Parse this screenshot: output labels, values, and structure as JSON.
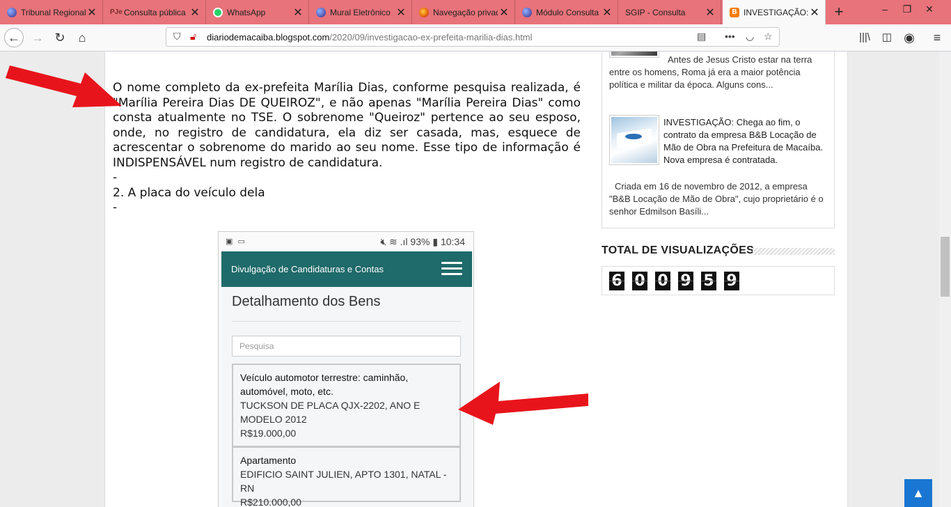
{
  "browser": {
    "tabs": [
      {
        "label": "Tribunal Regional Eleitoral",
        "icon": "globe-icon",
        "color": "#5b4fb3"
      },
      {
        "label": "Consulta pública",
        "icon": "pje-icon",
        "color": "#7a2e2e"
      },
      {
        "label": "WhatsApp",
        "icon": "whatsapp-icon",
        "color": "#25d366"
      },
      {
        "label": "Mural Eletrônico",
        "icon": "globe-icon",
        "color": "#5b4fb3"
      },
      {
        "label": "Navegação privada",
        "icon": "firefox-icon",
        "color": "#e66000"
      },
      {
        "label": "Módulo Consulta",
        "icon": "globe-icon",
        "color": "#5b4fb3"
      },
      {
        "label": "SGIP - Consulta",
        "icon": "",
        "color": ""
      },
      {
        "label": "INVESTIGAÇÃO: Chega ao fim",
        "icon": "blogger-icon",
        "color": "#f57d00"
      }
    ],
    "new_tab": "+",
    "window_buttons": {
      "minimize": "–",
      "restore": "❐",
      "close": "✕"
    },
    "url_host": "diariodemacaiba.blogspot.com",
    "url_path": "/2020/09/investigacao-ex-prefeita-marilia-dias.html"
  },
  "article": {
    "paragraph": "O nome completo da ex-prefeita Marília Dias, conforme pesquisa realizada, é \"Marília Pereira Dias DE QUEIROZ\", e não apenas \"Marília Pereira Dias\" como consta atualmente no TSE. O sobrenome \"Queiroz\" pertence ao seu esposo, onde, no registro de candidatura, ela diz ser casada, mas, esquece de acrescentar o sobrenome do marido ao seu nome. Esse tipo de informação é INDISPENSÁVEL num registro de candidatura.",
    "dash": "-",
    "item2": "2. A placa do veículo dela"
  },
  "phone": {
    "status_time": "10:34",
    "status_battery": "93%",
    "app_title": "Divulgação de Candidaturas e Contas",
    "section_title": "Detalhamento dos Bens",
    "search_placeholder": "Pesquisa",
    "assets": [
      {
        "title": "Veículo automotor terrestre: caminhão, automóvel, moto, etc.",
        "description": "TUCKSON DE PLACA QJX-2202, ANO E MODELO 2012",
        "value": "R$19.000,00"
      },
      {
        "title": "Apartamento",
        "description": "EDIFICIO SAINT JULIEN, APTO 1301, NATAL - RN",
        "value": "R$210.000,00"
      }
    ]
  },
  "sidebar": {
    "post1_excerpt": "Antes de Jesus Cristo estar na terra entre os homens, Roma já era a maior potência política e militar da época. Alguns cons...",
    "post2_title": "INVESTIGAÇÃO: Chega ao fim, o contrato da empresa B&B Locação de Mão de Obra na Prefeitura de Macaíba. Nova empresa é contratada.",
    "post2_excerpt": "Criada em 16 de novembro de 2012, a empresa \"B&B Locação de Mão de Obra\", cujo proprietário é o senhor Edmilson Basíli...",
    "views_title": "TOTAL DE VISUALIZAÇÕES",
    "views_digits": [
      "6",
      "0",
      "0",
      "9",
      "5",
      "9"
    ]
  },
  "colors": {
    "tabbar": "#e8737a",
    "appbar": "#1f6a6a",
    "arrow": "#e8141b",
    "to_top": "#1976d2"
  }
}
